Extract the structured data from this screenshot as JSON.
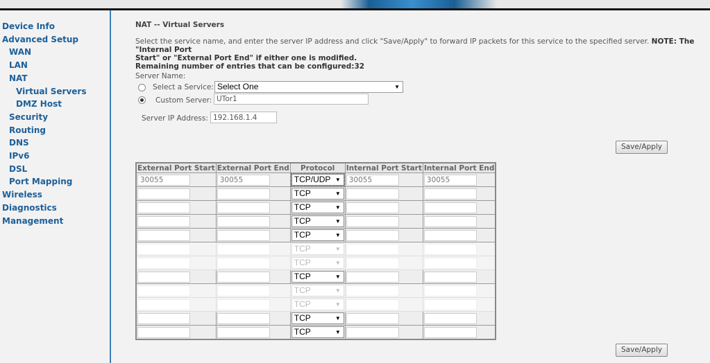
{
  "sidebar": {
    "items": [
      {
        "label": "Device Info",
        "level": 0
      },
      {
        "label": "Advanced Setup",
        "level": 0
      },
      {
        "label": "WAN",
        "level": 1
      },
      {
        "label": "LAN",
        "level": 1
      },
      {
        "label": "NAT",
        "level": 1
      },
      {
        "label": "Virtual Servers",
        "level": 2
      },
      {
        "label": "DMZ Host",
        "level": 2
      },
      {
        "label": "Security",
        "level": 1
      },
      {
        "label": "Routing",
        "level": 1
      },
      {
        "label": "DNS",
        "level": 1
      },
      {
        "label": "IPv6",
        "level": 1
      },
      {
        "label": "DSL",
        "level": 1
      },
      {
        "label": "Port Mapping",
        "level": 1
      },
      {
        "label": "Wireless",
        "level": 0
      },
      {
        "label": "Diagnostics",
        "level": 0
      },
      {
        "label": "Management",
        "level": 0
      }
    ]
  },
  "page": {
    "title": "NAT -- Virtual Servers",
    "instructions": "Select the service name, and enter the server IP address and click \"Save/Apply\" to forward IP packets for this service to the specified server.",
    "note_line1": "NOTE: The \"Internal Port",
    "note_line2": "Start\" or \"External Port End\" if either one is modified.",
    "remaining": "Remaining number of entries that can be configured:32"
  },
  "form": {
    "server_name_label": "Server Name:",
    "select_service_label": "Select a Service:",
    "select_service_value": "Select One",
    "custom_server_label": "Custom Server:",
    "custom_server_value": "UTor1",
    "server_ip_label": "Server IP Address:",
    "server_ip_value": "192.168.1.4",
    "selected_option": "custom"
  },
  "table": {
    "headers": [
      "External Port Start",
      "External Port End",
      "Protocol",
      "Internal Port Start",
      "Internal Port End"
    ],
    "rows": [
      {
        "ext_start": "30055",
        "ext_end": "30055",
        "protocol": "TCP/UDP",
        "int_start": "30055",
        "int_end": "30055"
      },
      {
        "ext_start": "",
        "ext_end": "",
        "protocol": "TCP",
        "int_start": "",
        "int_end": ""
      },
      {
        "ext_start": "",
        "ext_end": "",
        "protocol": "TCP",
        "int_start": "",
        "int_end": ""
      },
      {
        "ext_start": "",
        "ext_end": "",
        "protocol": "TCP",
        "int_start": "",
        "int_end": ""
      },
      {
        "ext_start": "",
        "ext_end": "",
        "protocol": "TCP",
        "int_start": "",
        "int_end": ""
      },
      {
        "ext_start": "",
        "ext_end": "",
        "protocol": "TCP",
        "int_start": "",
        "int_end": "",
        "faded": true
      },
      {
        "ext_start": "",
        "ext_end": "",
        "protocol": "TCP",
        "int_start": "",
        "int_end": "",
        "faded": true
      },
      {
        "ext_start": "",
        "ext_end": "",
        "protocol": "TCP",
        "int_start": "",
        "int_end": ""
      },
      {
        "ext_start": "",
        "ext_end": "",
        "protocol": "TCP",
        "int_start": "",
        "int_end": "",
        "faded": true
      },
      {
        "ext_start": "",
        "ext_end": "",
        "protocol": "TCP",
        "int_start": "",
        "int_end": "",
        "faded": true
      },
      {
        "ext_start": "",
        "ext_end": "",
        "protocol": "TCP",
        "int_start": "",
        "int_end": ""
      },
      {
        "ext_start": "",
        "ext_end": "",
        "protocol": "TCP",
        "int_start": "",
        "int_end": ""
      }
    ]
  },
  "buttons": {
    "save_apply": "Save/Apply"
  },
  "colors": {
    "nav": "#1d5f99",
    "background": "#f2f2f2"
  }
}
